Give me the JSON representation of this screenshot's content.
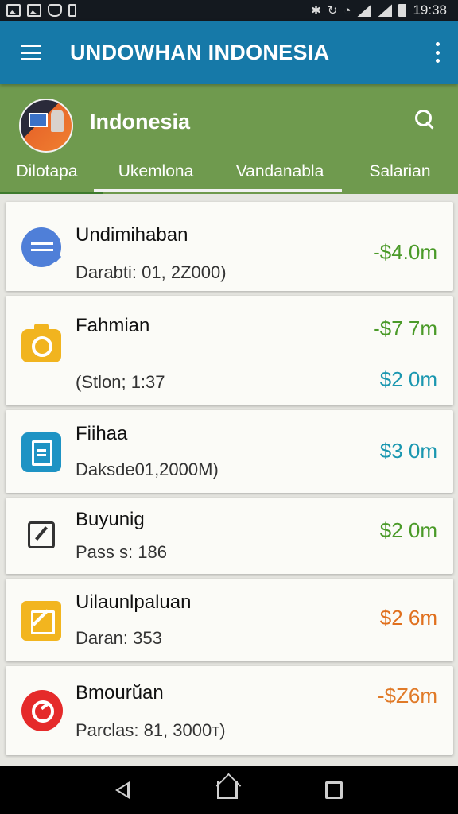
{
  "status_bar": {
    "time": "19:38",
    "left_icons": [
      "image-icon",
      "image-icon",
      "alarm-icon",
      "battery-saver-icon"
    ],
    "right_icons": [
      "bluetooth-icon",
      "sync-icon",
      "wifi-icon",
      "signal-icon",
      "signal-icon",
      "battery-icon"
    ]
  },
  "app_bar": {
    "title": "UNDOWHAN INDONESIA",
    "menu_icon": "menu-icon",
    "more_icon": "more-vert-icon",
    "color": "#1679a8"
  },
  "header": {
    "title": "Indonesia",
    "search_icon": "search-icon",
    "color": "#6f9a4e",
    "tabs": [
      {
        "label": "Dilotapa"
      },
      {
        "label": "Ukemlona"
      },
      {
        "label": "Vandanabla"
      },
      {
        "label": "Salarian"
      }
    ]
  },
  "list": {
    "items": [
      {
        "title": "Undimihaban",
        "subtitle": "Darabti: 01, 2Z000)",
        "amount": "-$4.0m",
        "amount_color": "#4a9a28",
        "icon": "chat-icon"
      },
      {
        "title": "Fahmian",
        "subtitle": "(Stlon; 1:37",
        "amount": "-$7 7m",
        "amount2": "$2 0m",
        "amount_color": "#4a9a28",
        "amount2_color": "#1a97b0",
        "icon": "camera-icon"
      },
      {
        "title": "Fiihaa",
        "subtitle": "Daksde01,2000M)",
        "amount": "$3 0m",
        "amount_color": "#1a97b0",
        "icon": "clipboard-icon"
      },
      {
        "title": "Buyunig",
        "subtitle": "Pass s: 186",
        "amount": "$2 0m",
        "amount_color": "#4a9a28",
        "icon": "edit-icon"
      },
      {
        "title": "Uilaunlpaluan",
        "subtitle": "Daran: 353",
        "amount": "$2 6m",
        "amount_color": "#e0701e",
        "icon": "note-icon"
      },
      {
        "title": "Bmourŭan",
        "subtitle": "Parclas: 81, 3000т)",
        "amount": "-$Z6m",
        "amount_color": "#e07a28",
        "icon": "target-icon"
      }
    ]
  },
  "nav_bar": {
    "icons": [
      "back-icon",
      "home-icon",
      "recents-icon"
    ]
  }
}
